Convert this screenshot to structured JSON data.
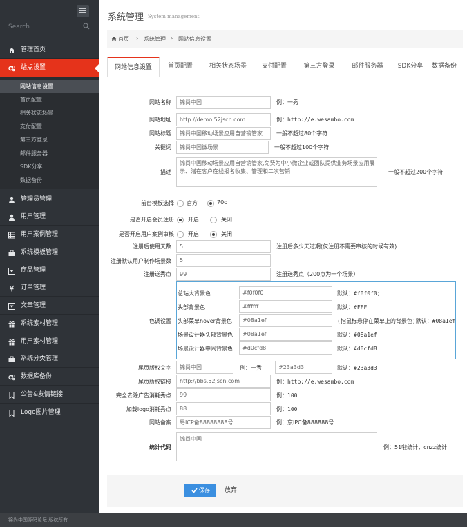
{
  "sidebar": {
    "search_placeholder": "Search",
    "menu": [
      {
        "label": "管理首页",
        "icon": "home-icon"
      },
      {
        "label": "站点设置",
        "icon": "cogs-icon"
      },
      {
        "label": "管理员管理",
        "icon": "user-icon"
      },
      {
        "label": "用户管理",
        "icon": "user-icon"
      },
      {
        "label": "用户案例管理",
        "icon": "table-icon"
      },
      {
        "label": "系统模板管理",
        "icon": "briefcase-icon"
      },
      {
        "label": "商品管理",
        "icon": "square-caret-icon"
      },
      {
        "label": "订单管理",
        "icon": "yen-icon"
      },
      {
        "label": "文章管理",
        "icon": "square-caret-icon"
      },
      {
        "label": "系统素材管理",
        "icon": "gift-icon"
      },
      {
        "label": "用户素材管理",
        "icon": "gift-icon"
      },
      {
        "label": "系统分类管理",
        "icon": "briefcase-icon"
      },
      {
        "label": "数据库备份",
        "icon": "cogs-icon"
      },
      {
        "label": "公告&友情链接",
        "icon": "bookmark-icon"
      },
      {
        "label": "Logo图片管理",
        "icon": "bookmark-icon"
      }
    ],
    "submenu": [
      "网站信息设置",
      "首页配置",
      "相关状态场景",
      "支付配置",
      "第三方登录",
      "邮件服务器",
      "SDK分享",
      "数据备份"
    ]
  },
  "footer": {
    "text": "锦尚中国源码论坛 版权所有"
  },
  "header": {
    "title": "系统管理",
    "subtitle": "System management"
  },
  "breadcrumb": {
    "home": "首页",
    "sep": "›",
    "level1": "系统管理",
    "level2": "网站信息设置"
  },
  "tabs": [
    "网站信息设置",
    "首页配置",
    "相关状态场景",
    "支付配置",
    "第三方登录",
    "邮件服务器",
    "SDK分享",
    "数据备份"
  ],
  "form": {
    "site_name": {
      "label": "网站名称",
      "value": "锦尚中国",
      "hint": "例：一秀"
    },
    "site_url": {
      "label": "网站地址",
      "value": "http://demo.52jscn.com",
      "hint": "例：http://e.wesambo.com"
    },
    "site_title": {
      "label": "网站标题",
      "value": "锦尚中国移动场景应用自营销管家",
      "hint": "一般不超过80个字符"
    },
    "keywords": {
      "label": "关键词",
      "value": "锦尚中国微场景",
      "hint": "一般不超过100个字符"
    },
    "description": {
      "label": "描述",
      "value": "锦尚中国移动场景应用自营销管家,免费为中小微企业或团队提供业务场景应用展示、潜在客户在线报名收集、管理和二次营销",
      "hint": "一般不超过200个字符"
    },
    "template": {
      "label": "前台模板选择",
      "options": [
        "官方",
        "70c"
      ],
      "selected": 1
    },
    "member_register": {
      "label": "是否开启会员注册",
      "options": [
        "开启",
        "关闭"
      ],
      "selected": 0
    },
    "case_review": {
      "label": "是否开启用户案例审核",
      "options": [
        "开启",
        "关闭"
      ],
      "selected": 1
    },
    "expire_days": {
      "label": "注册后使用天数",
      "value": "5",
      "hint": "注册后多少天过期(仅注册不需要审核的时候有效)"
    },
    "default_scenes": {
      "label": "注册默认用户制作场景数",
      "value": "5"
    },
    "gift_points": {
      "label": "注册送秀点",
      "value": "99",
      "hint": "注册送秀点（200点为一个场景）"
    },
    "color": {
      "label": "色调设置",
      "rows": [
        {
          "label": "总站大背景色",
          "value": "#f0f0f0",
          "hint": "默认：#f0f0f0;"
        },
        {
          "label": "头部背景色",
          "value": "#ffffff",
          "hint": "默认：#FFF"
        },
        {
          "label": "头部菜单hover背景色",
          "value": "#08a1ef",
          "hint": "(指鼠标悬停在菜单上的背景色)默认：#08a1ef"
        },
        {
          "label": "场景设计器头部背景色",
          "value": "#08a1ef",
          "hint": "默认：#08a1ef"
        },
        {
          "label": "场景设计器中间背景色",
          "value": "#d0cfd8",
          "hint": "默认：#d0cfd8"
        }
      ]
    },
    "copyright_text": {
      "label": "尾页版权文字",
      "value": "锦尚中国",
      "example": "例：一秀",
      "color_value": "#23a3d3",
      "hint": "默认：#23a3d3"
    },
    "copyright_link": {
      "label": "尾页版权链接",
      "value": "http://bbs.52jscn.com",
      "hint": "例：http://e.wesambo.com"
    },
    "remove_ads": {
      "label": "完全去除广告消耗秀点",
      "value": "99",
      "hint": "例：100"
    },
    "logo_cost": {
      "label": "加载logo消耗秀点",
      "value": "88",
      "hint": "例：100"
    },
    "icp": {
      "label": "网站备案",
      "value": "粤ICP备88888888号",
      "hint": "例：京IPC备888888号"
    },
    "stats": {
      "label": "统计代码",
      "value": "锦尚中国",
      "hint": "例：51啦统计，cnzz统计"
    }
  },
  "actions": {
    "save": "保存",
    "cancel": "放弃"
  }
}
